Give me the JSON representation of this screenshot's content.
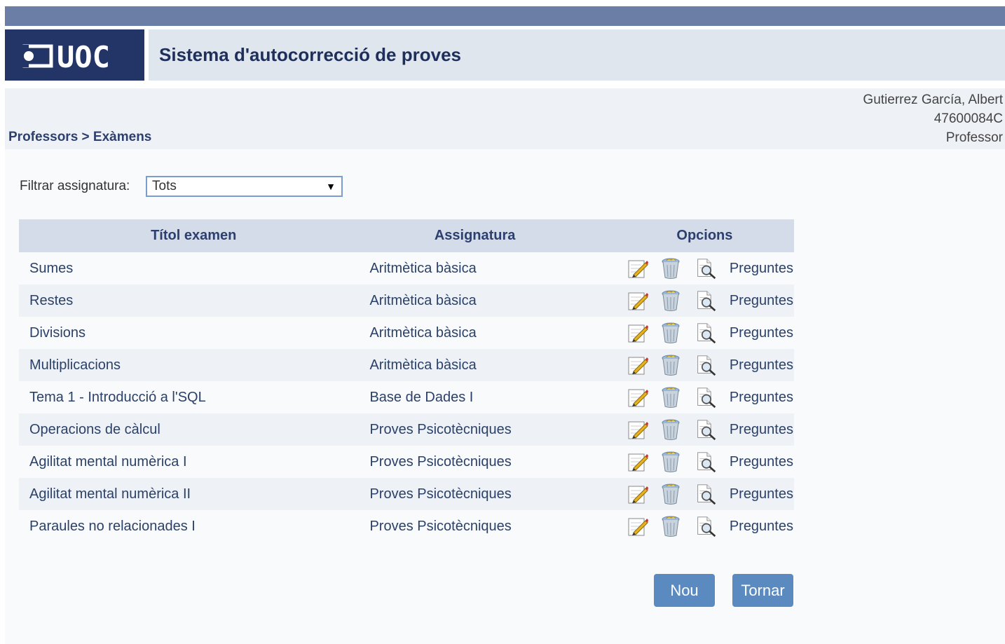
{
  "header": {
    "logo_text": "UOC",
    "app_title": "Sistema d'autocorrecció de proves"
  },
  "breadcrumb": "Professors > Exàmens",
  "user": {
    "name": "Gutierrez García, Albert",
    "id": "47600084C",
    "role": "Professor"
  },
  "filter": {
    "label": "Filtrar assignatura:",
    "selected": "Tots"
  },
  "table": {
    "headers": [
      "Títol examen",
      "Assignatura",
      "Opcions"
    ],
    "rows": [
      {
        "title": "Sumes",
        "subject": "Aritmètica bàsica",
        "link": "Preguntes"
      },
      {
        "title": "Restes",
        "subject": "Aritmètica bàsica",
        "link": "Preguntes"
      },
      {
        "title": "Divisions",
        "subject": "Aritmètica bàsica",
        "link": "Preguntes"
      },
      {
        "title": "Multiplicacions",
        "subject": "Aritmètica bàsica",
        "link": "Preguntes"
      },
      {
        "title": "Tema 1 - Introducció a l'SQL",
        "subject": "Base de Dades I",
        "link": "Preguntes"
      },
      {
        "title": "Operacions de càlcul",
        "subject": "Proves Psicotècniques",
        "link": "Preguntes"
      },
      {
        "title": "Agilitat mental numèrica I",
        "subject": "Proves Psicotècniques",
        "link": "Preguntes"
      },
      {
        "title": "Agilitat mental numèrica II",
        "subject": "Proves Psicotècniques",
        "link": "Preguntes"
      },
      {
        "title": "Paraules no relacionades I",
        "subject": "Proves Psicotècniques",
        "link": "Preguntes"
      }
    ]
  },
  "buttons": {
    "new": "Nou",
    "back": "Tornar"
  },
  "colors": {
    "top_strip": "#6b7ea6",
    "logo_bg": "#233566",
    "header_bg": "#dfe6ee",
    "table_header_bg": "#d3dce8",
    "button_bg": "#5b8ac0"
  },
  "icons": [
    "edit-icon",
    "trash-icon",
    "search-document-icon"
  ]
}
